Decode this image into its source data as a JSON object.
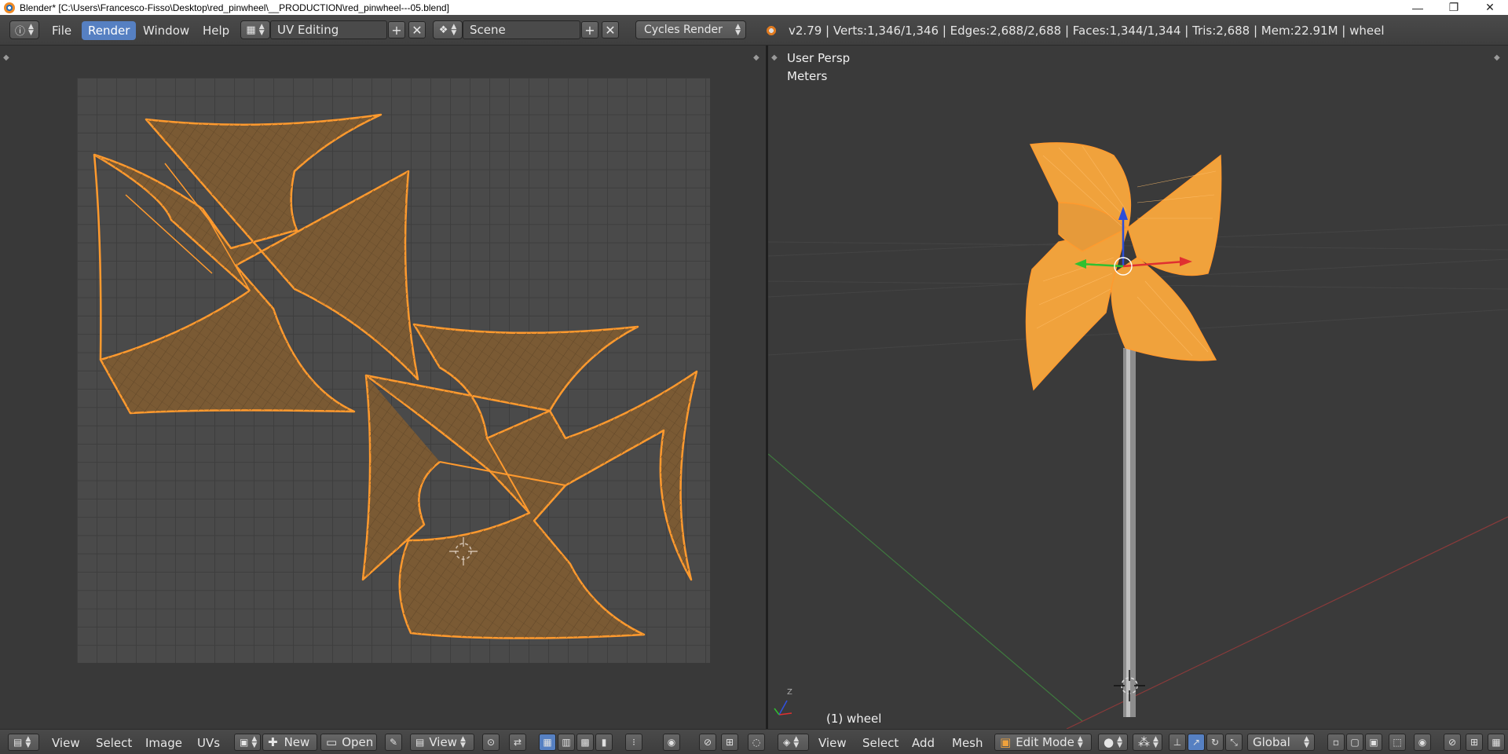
{
  "window": {
    "title": "Blender* [C:\\Users\\Francesco-Fisso\\Desktop\\red_pinwheel\\__PRODUCTION\\red_pinwheel---05.blend]",
    "min_glyph": "—",
    "max_glyph": "❐",
    "close_glyph": "✕"
  },
  "topbar": {
    "menus": [
      "File",
      "Render",
      "Window",
      "Help"
    ],
    "active_menu": "Render",
    "layout_name": "UV Editing",
    "scene_name": "Scene",
    "engine": "Cycles Render",
    "plus_glyph": "+",
    "x_glyph": "✕",
    "stats": "v2.79 | Verts:1,346/1,346 | Edges:2,688/2,688 | Faces:1,344/1,344 | Tris:2,688 | Mem:22.91M | wheel"
  },
  "viewport": {
    "view_label": "User Persp",
    "units_label": "Meters",
    "object_label": "(1) wheel",
    "axis_z": "Z"
  },
  "uv_editor_header": {
    "menus": [
      "View",
      "Select",
      "Image",
      "UVs"
    ],
    "new_label": "New",
    "open_label": "Open",
    "view_label": "View"
  },
  "view3d_header": {
    "menus": [
      "View",
      "Select",
      "Add",
      "Mesh"
    ],
    "mode": "Edit Mode",
    "orientation": "Global"
  },
  "colors": {
    "accent": "#5680c2",
    "uv_fill": "#7a5a34",
    "uv_edge": "#ff9a2e",
    "mesh_fill": "#f0a23c",
    "background": "#393939"
  }
}
